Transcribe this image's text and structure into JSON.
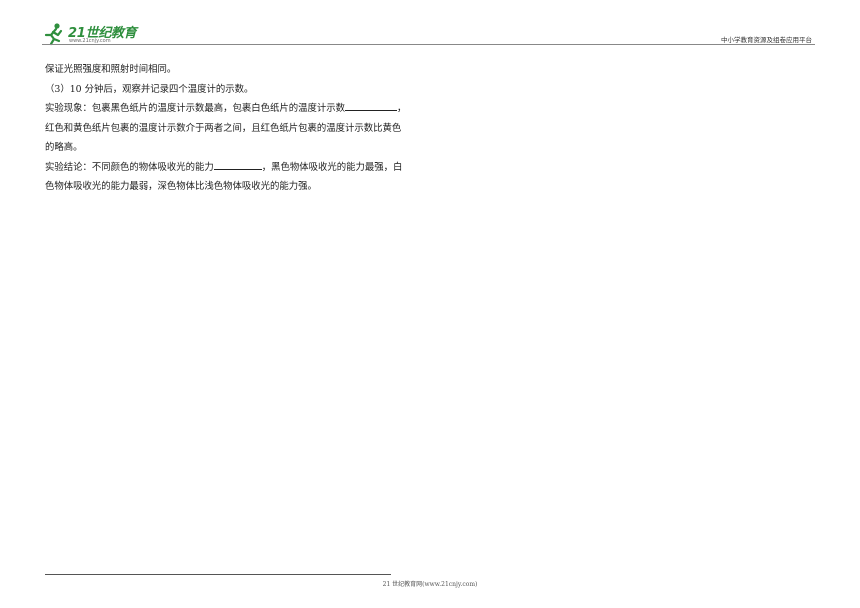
{
  "header": {
    "logo_text": "21世纪教育",
    "logo_url": "www.21cnjy.com",
    "right_text": "中小学教育资源及组卷应用平台"
  },
  "content": {
    "lines": [
      "保证光照强度和照射时间相同。",
      "（3）10 分钟后，观察并记录四个温度计的示数。",
      {
        "before": "实验现象：包裹黑色纸片的温度计示数最高，包裹白色纸片的温度计示数",
        "after": "，"
      },
      "红色和黄色纸片包裹的温度计示数介于两者之间，且红色纸片包裹的温度计示数比黄色",
      "的略高。",
      {
        "before": "实验结论：不同颜色的物体吸收光的能力",
        "after": "，黑色物体吸收光的能力最强，白"
      },
      "色物体吸收光的能力最弱，深色物体比浅色物体吸收光的能力强。"
    ]
  },
  "footer": {
    "text": "21 世纪教育网(www.21cnjy.com)"
  },
  "colors": {
    "logo_green": "#2f8f3e",
    "text": "#222222"
  }
}
